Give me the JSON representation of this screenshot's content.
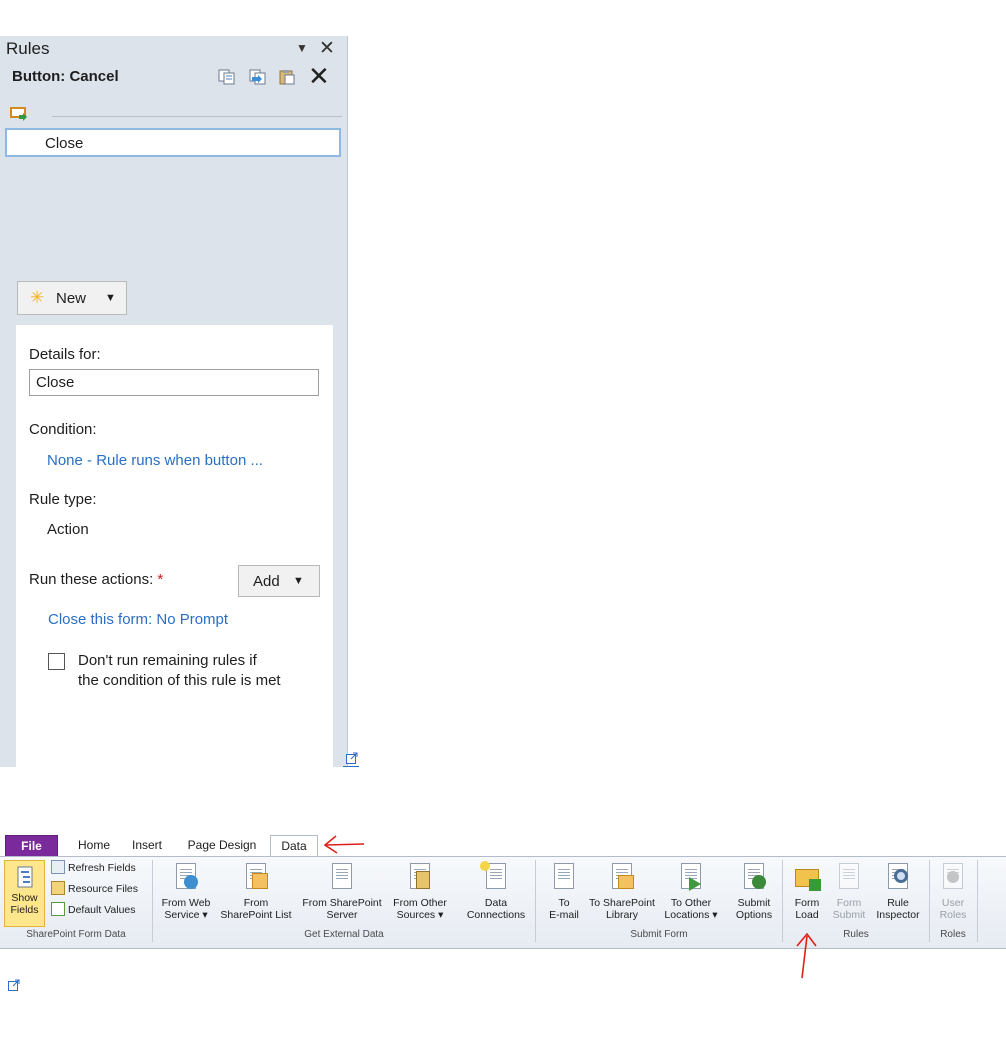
{
  "rules_pane": {
    "title": "Rules",
    "pane_menu_glyph": "▼",
    "close_glyph": "✕",
    "subtitle": "Button: Cancel",
    "toolbar": {
      "copy_icon": "copy-icon",
      "paste_icon": "paste-rule-icon",
      "clipboard_icon": "clipboard-icon",
      "delete_glyph": "✕"
    },
    "rules": [
      {
        "label": "Close"
      }
    ],
    "new_button": {
      "label": "New",
      "arrow": "▼",
      "icon": "new-star-icon"
    },
    "details": {
      "details_for_label": "Details for:",
      "name_value": "Close",
      "condition_label": "Condition:",
      "condition_value": "None - Rule runs when button ...",
      "rule_type_label": "Rule type:",
      "rule_type_value": "Action",
      "run_actions_label": "Run these actions:",
      "required_mark": "*",
      "add_button": {
        "label": "Add",
        "arrow": "▼"
      },
      "action": "Close this form: No Prompt",
      "checkbox_line1": "Don't run remaining rules if",
      "checkbox_line2": "the condition of this rule is met",
      "checkbox_checked": false
    }
  },
  "ribbon": {
    "tabs": [
      {
        "label": "File",
        "active": false
      },
      {
        "label": "Home",
        "active": false
      },
      {
        "label": "Insert",
        "active": false
      },
      {
        "label": "Page Design",
        "active": false
      },
      {
        "label": "Data",
        "active": true
      }
    ],
    "groups": {
      "sharepoint_form_data": {
        "label": "SharePoint Form Data",
        "show_fields": [
          "Show",
          "Fields"
        ],
        "small": [
          "Refresh Fields",
          "Resource Files",
          "Default Values"
        ]
      },
      "get_external_data": {
        "label": "Get External Data",
        "buttons": [
          [
            "From Web",
            "Service ▾"
          ],
          [
            "From",
            "SharePoint List"
          ],
          [
            "From SharePoint",
            "Server"
          ],
          [
            "From Other",
            "Sources ▾"
          ],
          [
            "Data",
            "Connections"
          ]
        ]
      },
      "submit_form": {
        "label": "Submit Form",
        "buttons": [
          [
            "To",
            "E-mail"
          ],
          [
            "To SharePoint",
            "Library"
          ],
          [
            "To Other",
            "Locations ▾"
          ],
          [
            "Submit",
            "Options"
          ]
        ]
      },
      "rules": {
        "label": "Rules",
        "buttons": [
          [
            "Form",
            "Load"
          ],
          [
            "Form",
            "Submit"
          ],
          [
            "Rule",
            "Inspector"
          ]
        ]
      },
      "roles": {
        "label": "Roles",
        "buttons": [
          [
            "User",
            "Roles"
          ]
        ]
      }
    }
  },
  "colors": {
    "accent_link": "#2a6fc4",
    "file_tab": "#7a2a9b",
    "annotation": "#e0201a",
    "pane_bg": "#dde3ea"
  }
}
